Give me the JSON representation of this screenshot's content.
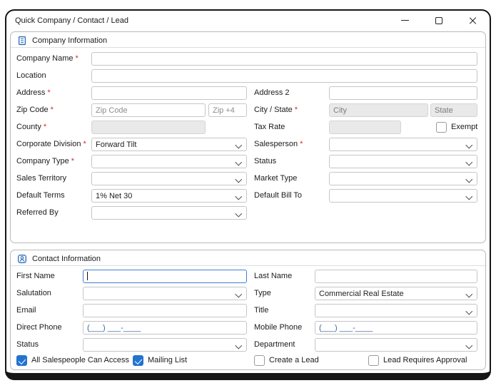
{
  "window": {
    "title": "Quick Company / Contact / Lead"
  },
  "misc": {
    "required_marker": "*"
  },
  "company_info": {
    "header": "Company Information",
    "labels": {
      "company_name": "Company Name",
      "location": "Location",
      "address": "Address",
      "address2": "Address 2",
      "zip_code": "Zip Code",
      "city_state": "City / State",
      "county": "County",
      "tax_rate": "Tax Rate",
      "exempt": "Exempt",
      "corporate_division": "Corporate Division",
      "salesperson": "Salesperson",
      "company_type": "Company Type",
      "status": "Status",
      "sales_territory": "Sales Territory",
      "market_type": "Market Type",
      "default_terms": "Default Terms",
      "default_bill_to": "Default Bill To",
      "referred_by": "Referred By"
    },
    "placeholders": {
      "zip_code": "Zip Code",
      "zip_plus4": "Zip +4",
      "city": "City",
      "state": "State"
    },
    "values": {
      "corporate_division": "Forward Tilt",
      "default_terms": "1% Net 30"
    }
  },
  "contact_info": {
    "header": "Contact Information",
    "labels": {
      "first_name": "First Name",
      "last_name": "Last Name",
      "salutation": "Salutation",
      "type": "Type",
      "email": "Email",
      "title": "Title",
      "direct_phone": "Direct Phone",
      "mobile_phone": "Mobile Phone",
      "status": "Status",
      "department": "Department"
    },
    "values": {
      "type": "Commercial Real Estate",
      "direct_phone": "(___) ___-____",
      "mobile_phone": "(___) ___-____"
    },
    "checkboxes": [
      {
        "label": "All Salespeople Can Access",
        "checked": true
      },
      {
        "label": "Mailing List",
        "checked": true
      },
      {
        "label": "Create a Lead",
        "checked": false
      },
      {
        "label": "Lead Requires Approval",
        "checked": false
      }
    ]
  },
  "colors": {
    "required": "#cf2e2e",
    "checkbox_checked": "#2373d1",
    "header_icon": "#2e6db4",
    "disabled_fill": "#e9e9e9",
    "phone_mask_text": "#3c66a4",
    "window_border": "#161616"
  }
}
